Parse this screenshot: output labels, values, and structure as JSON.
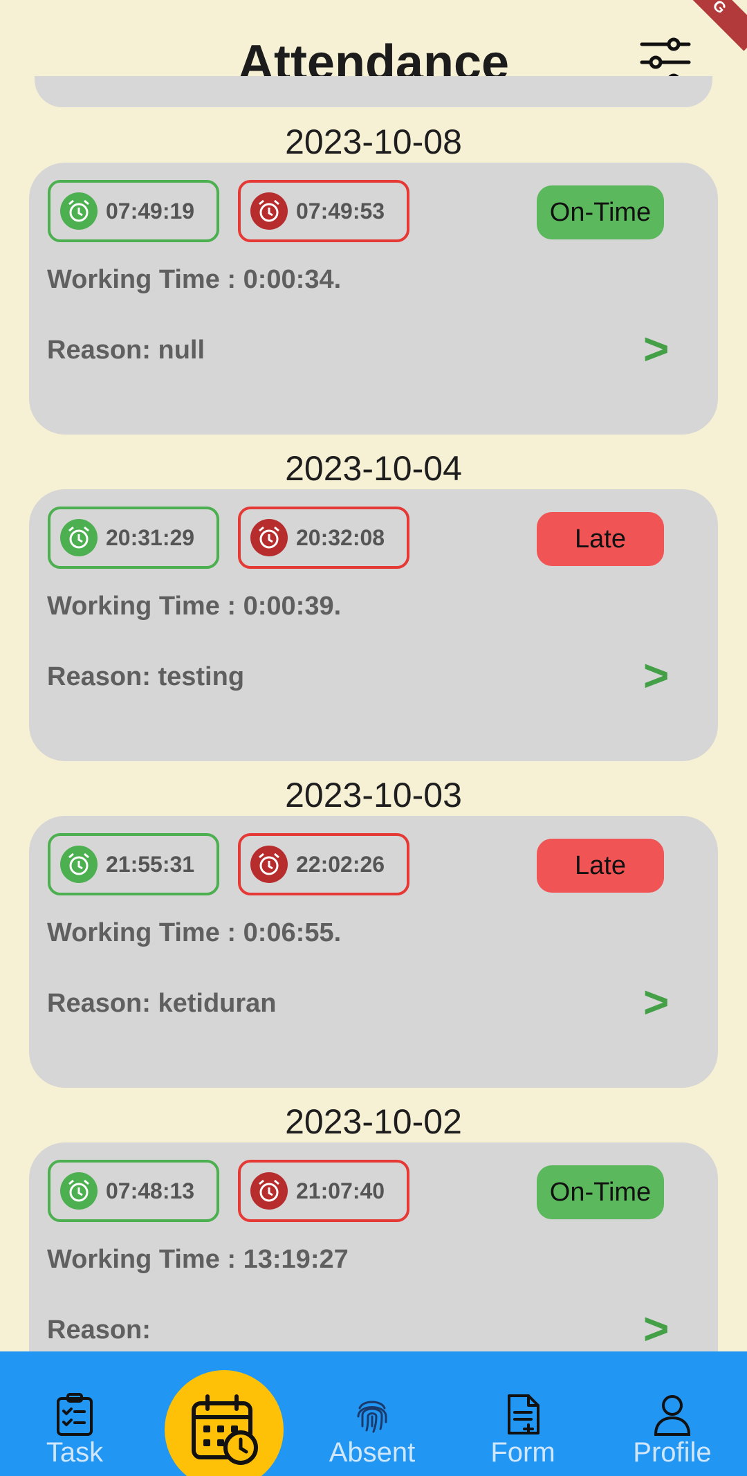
{
  "header": {
    "title": "Attendance",
    "filter_icon": "sliders-icon",
    "debug_banner": "G"
  },
  "entries": [
    {
      "date": "2023-10-08",
      "clock_in": "07:49:19",
      "clock_out": "07:49:53",
      "status": "On-Time",
      "working_time": "Working Time : 0:00:34.",
      "reason": "Reason: null",
      "arrow": ">"
    },
    {
      "date": "2023-10-04",
      "clock_in": "20:31:29",
      "clock_out": "20:32:08",
      "status": "Late",
      "working_time": "Working Time : 0:00:39.",
      "reason": "Reason: testing",
      "arrow": ">"
    },
    {
      "date": "2023-10-03",
      "clock_in": "21:55:31",
      "clock_out": "22:02:26",
      "status": "Late",
      "working_time": "Working Time : 0:06:55.",
      "reason": "Reason: ketiduran",
      "arrow": ">"
    },
    {
      "date": "2023-10-02",
      "clock_in": "07:48:13",
      "clock_out": "21:07:40",
      "status": "On-Time",
      "working_time": "Working Time : 13:19:27",
      "reason": "Reason:",
      "arrow": ">"
    }
  ],
  "nav": {
    "items": [
      {
        "label": "Task",
        "icon": "clipboard-check-icon"
      },
      {
        "label": "Absent",
        "icon": "fingerprint-icon"
      },
      {
        "label": "Form",
        "icon": "document-add-icon"
      },
      {
        "label": "Profile",
        "icon": "user-icon"
      }
    ],
    "center_icon": "calendar-clock-icon"
  },
  "colors": {
    "background": "#f6f0d4",
    "card": "#d6d6d6",
    "in_green": "#4caf50",
    "out_red": "#e53935",
    "ontime": "#5cb85c",
    "late": "#f05454",
    "nav_blue": "#2196f3",
    "fab_yellow": "#ffc107"
  }
}
